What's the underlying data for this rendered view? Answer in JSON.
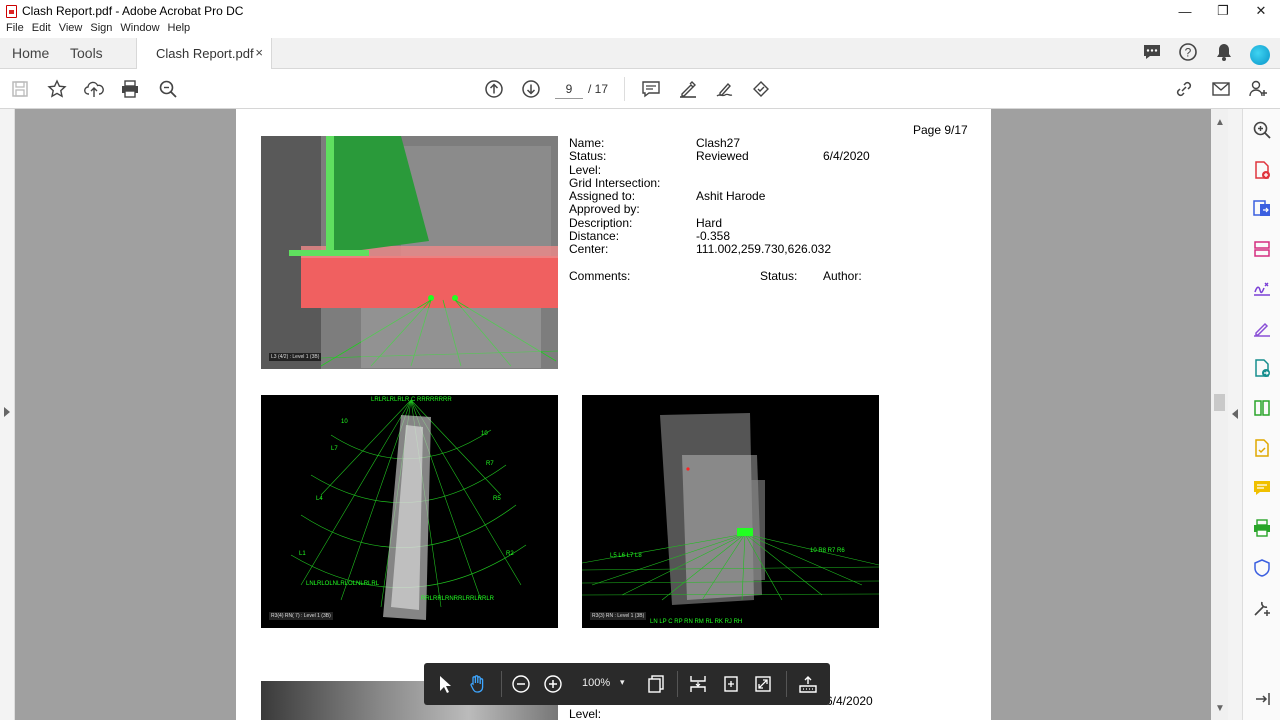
{
  "window": {
    "title": "Clash Report.pdf - Adobe Acrobat Pro DC",
    "minimize": "—",
    "maximize": "❐",
    "close": "✕"
  },
  "menu": [
    "File",
    "Edit",
    "View",
    "Sign",
    "Window",
    "Help"
  ],
  "tabs": {
    "home": "Home",
    "tools": "Tools",
    "document": "Clash Report.pdf",
    "close": "×"
  },
  "toolbar": {
    "current_page": "9",
    "total_pages": "/ 17"
  },
  "page": {
    "page_label": "Page 9/17",
    "fields": [
      {
        "label": "Name:",
        "value": "Clash27",
        "extra": ""
      },
      {
        "label": "Status:",
        "value": "Reviewed",
        "extra": "6/4/2020"
      },
      {
        "label": "Level:",
        "value": "",
        "extra": ""
      },
      {
        "label": "Grid Intersection:",
        "value": "",
        "extra": ""
      },
      {
        "label": "Assigned to:",
        "value": "Ashit Harode",
        "extra": ""
      },
      {
        "label": "Approved by:",
        "value": "",
        "extra": ""
      },
      {
        "label": "Description:",
        "value": "Hard",
        "extra": ""
      },
      {
        "label": "Distance:",
        "value": "-0.358",
        "extra": ""
      },
      {
        "label": "Center:",
        "value": "111.002,259.730,626.032",
        "extra": ""
      }
    ],
    "comments_header": {
      "comments": "Comments:",
      "status": "Status:",
      "author": "Author:"
    },
    "next": {
      "date": "6/4/2020",
      "level": "Level:"
    }
  },
  "floatbar": {
    "zoom": "100%",
    "caret": "▾"
  },
  "colors": {
    "accent_red": "#d7373f",
    "grid_green": "#22ff22",
    "clash_red": "#f06060",
    "steel_green": "#2a9a3a"
  }
}
